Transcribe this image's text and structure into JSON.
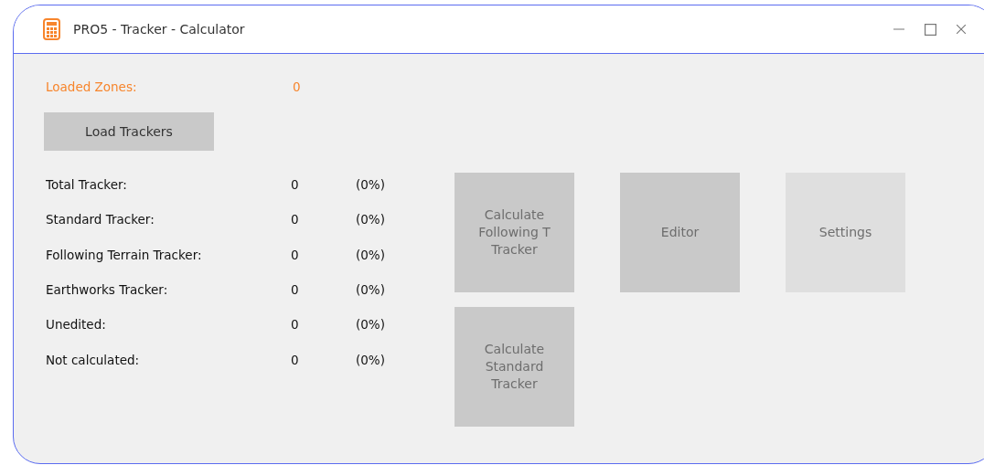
{
  "window": {
    "title": "PRO5 - Tracker - Calculator"
  },
  "loaded_zones": {
    "label": "Loaded Zones:",
    "value": "0"
  },
  "load_button": "Load Trackers",
  "stats": [
    {
      "label": "Total Tracker:",
      "value": "0",
      "percent": "(0%)"
    },
    {
      "label": "Standard Tracker:",
      "value": "0",
      "percent": "(0%)"
    },
    {
      "label": "Following Terrain Tracker:",
      "value": "0",
      "percent": "(0%)"
    },
    {
      "label": "Earthworks Tracker:",
      "value": "0",
      "percent": "(0%)"
    },
    {
      "label": "Unedited:",
      "value": "0",
      "percent": "(0%)"
    },
    {
      "label": "Not calculated:",
      "value": "0",
      "percent": "(0%)"
    }
  ],
  "tiles": [
    {
      "label": "Calculate Following T Tracker",
      "disabled": false
    },
    {
      "label": "Editor",
      "disabled": false
    },
    {
      "label": "Settings",
      "disabled": true
    },
    {
      "label": "Calculate Standard Tracker",
      "disabled": false
    }
  ]
}
